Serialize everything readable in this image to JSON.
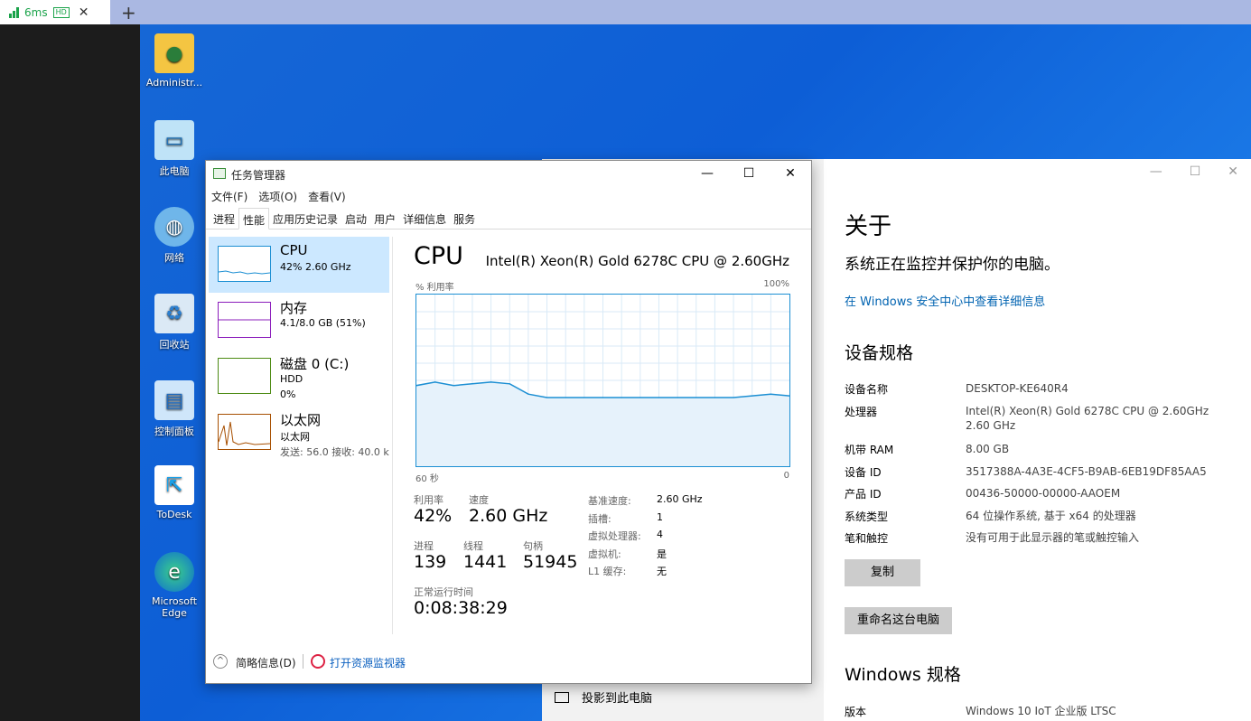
{
  "client": {
    "latency": "6ms",
    "hd_badge": "HD",
    "close_glyph": "✕",
    "new_tab_glyph": "+"
  },
  "desktop": {
    "icons": [
      {
        "label": "Administr...",
        "icon": "user-folder-icon"
      },
      {
        "label": "此电脑",
        "icon": "computer-icon"
      },
      {
        "label": "网络",
        "icon": "network-icon"
      },
      {
        "label": "回收站",
        "icon": "recycle-bin-icon"
      },
      {
        "label": "控制面板",
        "icon": "control-panel-icon"
      },
      {
        "label": "ToDesk",
        "icon": "todesk-icon"
      },
      {
        "label": "Microsoft Edge",
        "icon": "edge-icon"
      }
    ]
  },
  "taskmgr": {
    "title": "任务管理器",
    "controls": {
      "minimize": "—",
      "maximize": "☐",
      "close": "✕"
    },
    "menu": [
      "文件(F)",
      "选项(O)",
      "查看(V)"
    ],
    "tabs": [
      "进程",
      "性能",
      "应用历史记录",
      "启动",
      "用户",
      "详细信息",
      "服务"
    ],
    "active_tab": "性能",
    "resources": [
      {
        "name": "CPU",
        "line1": "42% 2.60 GHz",
        "line2": "",
        "color": "#1c8fd3"
      },
      {
        "name": "内存",
        "line1": "4.1/8.0 GB (51%)",
        "line2": "",
        "color": "#8b1dbb"
      },
      {
        "name": "磁盘 0 (C:)",
        "line1": "HDD",
        "line2": "0%",
        "color": "#4c8a12"
      },
      {
        "name": "以太网",
        "line1": "以太网",
        "line2": "发送: 56.0  接收: 40.0 k",
        "color": "#a74f01"
      }
    ],
    "cpu": {
      "heading": "CPU",
      "model": "Intel(R) Xeon(R) Gold 6278C CPU @ 2.60GHz",
      "graph_ylabel": "% 利用率",
      "graph_ymax": "100%",
      "graph_xlabel": "60 秒",
      "graph_xmin": "0",
      "utilization_label": "利用率",
      "utilization": "42%",
      "speed_label": "速度",
      "speed": "2.60 GHz",
      "processes_label": "进程",
      "processes": "139",
      "threads_label": "线程",
      "threads": "1441",
      "handles_label": "句柄",
      "handles": "51945",
      "uptime_label": "正常运行时间",
      "uptime": "0:08:38:29",
      "details": [
        {
          "k": "基准速度:",
          "v": "2.60 GHz"
        },
        {
          "k": "插槽:",
          "v": "1"
        },
        {
          "k": "虚拟处理器:",
          "v": "4"
        },
        {
          "k": "虚拟机:",
          "v": "是"
        },
        {
          "k": "L1 缓存:",
          "v": "无"
        }
      ]
    },
    "footer": {
      "less_details": "简略信息(D)",
      "resmon": "打开资源监视器"
    }
  },
  "settings": {
    "controls": {
      "minimize": "—",
      "maximize": "☐",
      "close": "✕"
    },
    "about_title": "关于",
    "status": "系统正在监控并保护你的电脑。",
    "security_link": "在 Windows 安全中心中查看详细信息",
    "device_spec_title": "设备规格",
    "specs": [
      {
        "k": "设备名称",
        "v": "DESKTOP-KE640R4"
      },
      {
        "k": "处理器",
        "v": "Intel(R) Xeon(R) Gold 6278C CPU @ 2.60GHz 2.60 GHz"
      },
      {
        "k": "机带 RAM",
        "v": "8.00 GB"
      },
      {
        "k": "设备 ID",
        "v": "3517388A-4A3E-4CF5-B9AB-6EB19DF85AA5"
      },
      {
        "k": "产品 ID",
        "v": "00436-50000-00000-AAOEM"
      },
      {
        "k": "系统类型",
        "v": "64 位操作系统, 基于 x64 的处理器"
      },
      {
        "k": "笔和触控",
        "v": "没有可用于此显示器的笔或触控输入"
      }
    ],
    "copy_button": "复制",
    "rename_button": "重命名这台电脑",
    "windows_spec_title": "Windows 规格",
    "version_label": "版本",
    "version_value": "Windows 10 IoT 企业版 LTSC",
    "project_label": "投影到此电脑"
  },
  "chart_data": {
    "type": "line",
    "x": [
      60,
      57,
      54,
      51,
      48,
      45,
      42,
      39,
      36,
      33,
      30,
      27,
      24,
      21,
      18,
      15,
      12,
      9,
      6,
      3,
      0
    ],
    "series": [
      {
        "values": [
          47,
          49,
          47,
          48,
          49,
          48,
          42,
          40,
          40,
          40,
          40,
          40,
          40,
          40,
          40,
          40,
          40,
          40,
          41,
          42,
          41
        ]
      }
    ],
    "ylim": [
      0,
      100
    ],
    "xlim": [
      60,
      0
    ],
    "ylabel": "% 利用率",
    "xlabel": "60 秒",
    "grid": true
  }
}
